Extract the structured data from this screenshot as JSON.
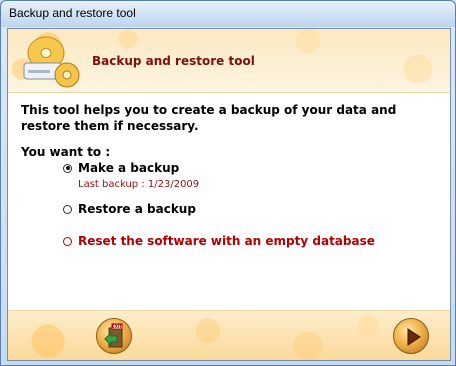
{
  "window": {
    "title": "Backup and restore tool"
  },
  "header": {
    "title": "Backup and restore tool",
    "logo_icon": "backup-disk-icon"
  },
  "intro": "This tool helps you to create a backup of your data and restore them if necessary.",
  "question": "You want to :",
  "options": [
    {
      "label": "Make a backup",
      "checked": true,
      "color": "#000000"
    },
    {
      "label": "Restore a backup",
      "checked": false,
      "color": "#000000"
    },
    {
      "label": "Reset the software with an empty database",
      "checked": false,
      "color": "#b00000"
    }
  ],
  "last_backup": "Last backup : 1/23/2009",
  "footer": {
    "exit_icon": "exit-door-icon",
    "exit_sign": "EXIT",
    "next_icon": "play-arrow-icon"
  },
  "colors": {
    "accent_red": "#7a1010",
    "orange": "#f0b24a"
  }
}
